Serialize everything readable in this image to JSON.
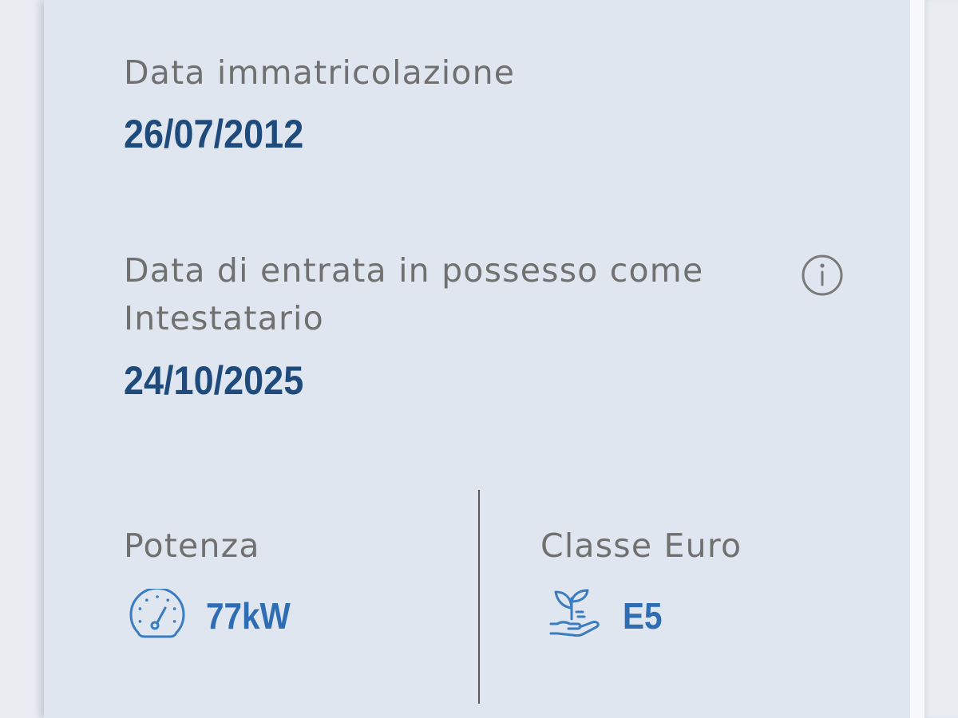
{
  "fields": {
    "registration_date": {
      "label": "Data immatricolazione",
      "value": "26/07/2012"
    },
    "ownership_date": {
      "label": "Data di entrata in possesso come Intestatario",
      "value": "24/10/2025",
      "info_icon": "info-icon"
    },
    "power": {
      "label": "Potenza",
      "value": "77kW",
      "icon": "speedometer-icon"
    },
    "euro_class": {
      "label": "Classe Euro",
      "value": "E5",
      "icon": "plant-in-hand-icon"
    }
  },
  "colors": {
    "card": "#dfe6ef",
    "label": "#707070",
    "date": "#1e4a7c",
    "value": "#2e6db3",
    "accent": "#3a7cc0",
    "info": "#7a7a7a",
    "divider": "#5a5a5a"
  }
}
